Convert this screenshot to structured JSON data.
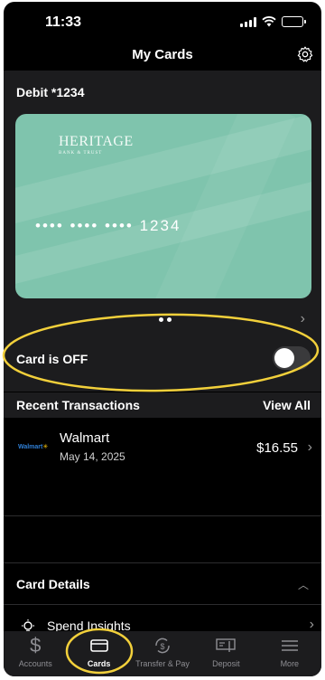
{
  "status_bar": {
    "time": "11:33"
  },
  "header": {
    "title": "My Cards",
    "settings_icon": "gear-icon"
  },
  "card": {
    "label": "Debit *1234",
    "brand": "HERITAGE",
    "brand_sub": "BANK & TRUST",
    "masked_number": "•••• •••• •••• 1234",
    "color": "#7fc4ad"
  },
  "card_status": {
    "label": "Card is OFF",
    "toggle_on": false
  },
  "transactions": {
    "title": "Recent Transactions",
    "view_all": "View All",
    "items": [
      {
        "merchant_logo": "Walmart",
        "merchant": "Walmart",
        "date": "May 14, 2025",
        "amount": "$16.55"
      }
    ]
  },
  "card_details": {
    "title": "Card Details"
  },
  "spend_insights": {
    "label": "Spend Insights"
  },
  "tabs": [
    {
      "label": "Accounts",
      "icon": "dollar-icon"
    },
    {
      "label": "Cards",
      "icon": "card-icon",
      "active": true
    },
    {
      "label": "Transfer & Pay",
      "icon": "transfer-icon"
    },
    {
      "label": "Deposit",
      "icon": "deposit-icon"
    },
    {
      "label": "More",
      "icon": "menu-icon"
    }
  ],
  "colors": {
    "background": "#000000",
    "surface": "#1c1c1e",
    "annotation": "#f2d03b"
  }
}
